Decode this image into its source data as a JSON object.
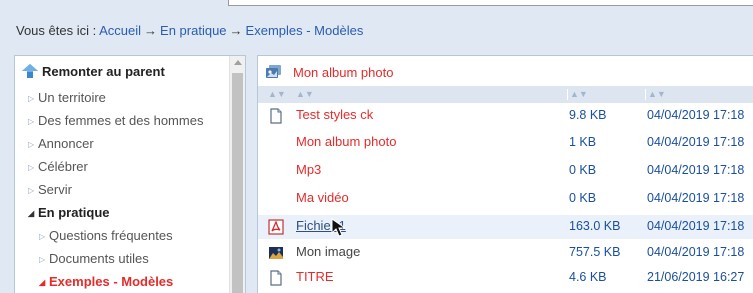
{
  "breadcrumb": {
    "prefix": "Vous êtes ici :",
    "items": [
      "Accueil",
      "En pratique",
      "Exemples - Modèles"
    ],
    "separator": "→"
  },
  "sidebar": {
    "parent_label": "Remonter au parent",
    "items": [
      {
        "label": "Un territoire",
        "state": "closed"
      },
      {
        "label": "Des femmes et des hommes",
        "state": "closed"
      },
      {
        "label": "Annoncer",
        "state": "closed"
      },
      {
        "label": "Célébrer",
        "state": "closed"
      },
      {
        "label": "Servir",
        "state": "closed"
      },
      {
        "label": "En pratique",
        "state": "open"
      },
      {
        "label": "Questions fréquentes",
        "state": "closed"
      },
      {
        "label": "Documents utiles",
        "state": "closed"
      },
      {
        "label": "Exemples - Modèles",
        "state": "current"
      }
    ]
  },
  "album": {
    "title": "Mon album photo",
    "icon": "album-icon"
  },
  "files": [
    {
      "name": "Test styles ck",
      "size": "9.8 KB",
      "date": "04/04/2019 17:18",
      "icon": "document-icon",
      "style": "red"
    },
    {
      "name": "Mon album photo",
      "size": "1 KB",
      "date": "04/04/2019 17:18",
      "icon": "",
      "style": "red"
    },
    {
      "name": "Mp3",
      "size": "0 KB",
      "date": "04/04/2019 17:18",
      "icon": "",
      "style": "red"
    },
    {
      "name": "Ma vidéo",
      "size": "0 KB",
      "date": "04/04/2019 17:18",
      "icon": "",
      "style": "red"
    },
    {
      "name": "Fichier 1",
      "size": "163.0 KB",
      "date": "04/04/2019 17:18",
      "icon": "pdf-icon",
      "style": "link"
    },
    {
      "name": "Mon image",
      "size": "757.5 KB",
      "date": "04/04/2019 17:18",
      "icon": "image-icon",
      "style": "dark"
    },
    {
      "name": "TITRE",
      "size": "4.6 KB",
      "date": "21/06/2019 16:27",
      "icon": "document-icon",
      "style": "red"
    }
  ],
  "colors": {
    "background": "#dfe8f3",
    "accent_red": "#e52b2b",
    "link_blue": "#2a5db0",
    "meta_blue": "#1a4f9e"
  }
}
